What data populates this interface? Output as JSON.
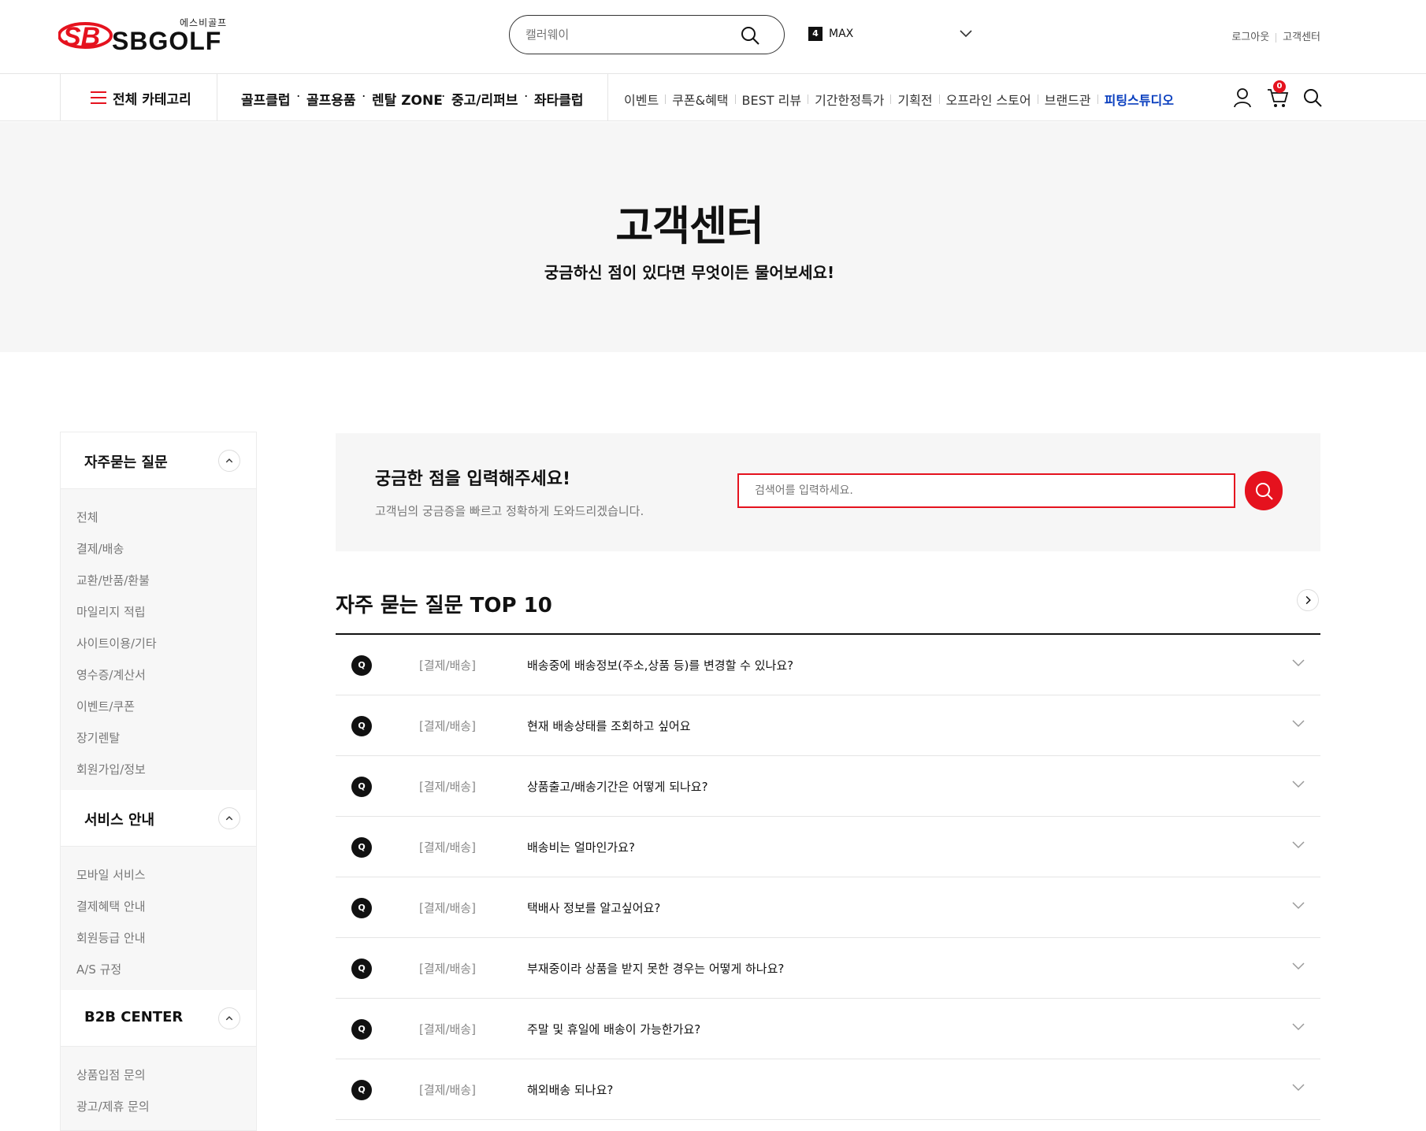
{
  "header": {
    "logo_text": "SBGOLF",
    "logo_sub": "에스비골프",
    "search_placeholder": "캘러웨이",
    "max_badge": "4",
    "max_label": "MAX",
    "util": [
      "로그아웃",
      "고객센터"
    ]
  },
  "gnb": {
    "all_category": "전체 카테고리",
    "main_menu": [
      "골프클럽",
      "골프용품",
      "렌탈 ZONE",
      "중고/리퍼브",
      "좌타클럽"
    ],
    "sub_menu": [
      "이벤트",
      "쿠폰&혜택",
      "BEST 리뷰",
      "기간한정특가",
      "기획전",
      "오프라인 스토어",
      "브랜드관",
      "피팅스튜디오"
    ],
    "cart_count": "0"
  },
  "hero": {
    "title": "고객센터",
    "subtitle": "궁금하신 점이 있다면 무엇이든 물어보세요!"
  },
  "sidebar": {
    "sections": [
      {
        "title": "자주묻는 질문",
        "items": [
          "전체",
          "결제/배송",
          "교환/반품/환불",
          "마일리지 적립",
          "사이트이용/기타",
          "영수증/계산서",
          "이벤트/쿠폰",
          "장기렌탈",
          "회원가입/정보"
        ]
      },
      {
        "title": "서비스 안내",
        "items": [
          "모바일 서비스",
          "결제혜택 안내",
          "회원등급 안내",
          "A/S 규정"
        ]
      },
      {
        "title": "B2B CENTER",
        "items": [
          "상품입점 문의",
          "광고/제휴 문의"
        ]
      }
    ]
  },
  "search": {
    "heading": "궁금한 점을 입력해주세요!",
    "desc": "고객님의 궁금증을 빠르고 정확하게 도와드리겠습니다.",
    "placeholder": "검색어를 입력하세요."
  },
  "faq": {
    "title": "자주 묻는 질문 TOP 10",
    "q_label": "Q",
    "rows": [
      {
        "category": "[결제/배송]",
        "question": "배송중에 배송정보(주소,상품 등)를 변경할 수 있나요?"
      },
      {
        "category": "[결제/배송]",
        "question": "현재 배송상태를 조회하고 싶어요"
      },
      {
        "category": "[결제/배송]",
        "question": "상품출고/배송기간은 어떻게 되나요?"
      },
      {
        "category": "[결제/배송]",
        "question": "배송비는 얼마인가요?"
      },
      {
        "category": "[결제/배송]",
        "question": "택배사 정보를 알고싶어요?"
      },
      {
        "category": "[결제/배송]",
        "question": "부재중이라 상품을 받지 못한 경우는 어떻게 하나요?"
      },
      {
        "category": "[결제/배송]",
        "question": "주말 및 휴일에 배송이 가능한가요?"
      },
      {
        "category": "[결제/배송]",
        "question": "해외배송 되나요?"
      }
    ]
  },
  "colors": {
    "accent": "#e5121e",
    "link_highlight": "#0a3fbf"
  }
}
